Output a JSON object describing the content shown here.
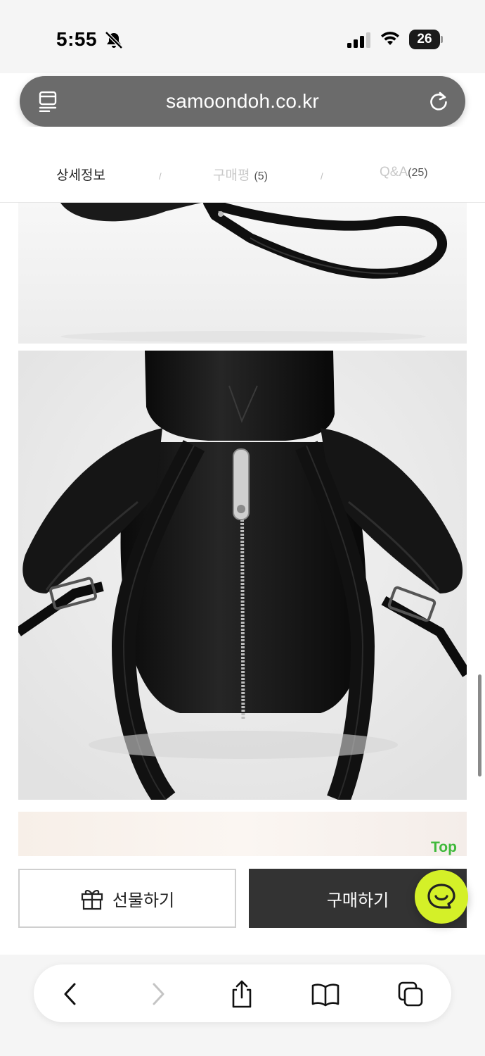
{
  "status_bar": {
    "time": "5:55",
    "battery": "26",
    "icons": [
      "bell-slash-icon",
      "signal-icon",
      "wifi-icon",
      "battery-icon"
    ]
  },
  "address_bar": {
    "url": "samoondoh.co.kr",
    "left_icon": "reader-icon",
    "right_icon": "reload-icon"
  },
  "tabs": [
    {
      "label": "상세정보",
      "count": "",
      "active": true
    },
    {
      "label": "구매평",
      "count": "(5)",
      "active": false
    },
    {
      "label": "Q&A",
      "count": "(25)",
      "active": false
    }
  ],
  "tab_separator": "/",
  "images": [
    {
      "subject": "black leather strap on white background"
    },
    {
      "subject": "black leather bear backpack, back view with zipper and straps"
    },
    {
      "subject": "next product image (partially visible)"
    }
  ],
  "top_button": "Top",
  "purchase_bar": {
    "gift_label": "선물하기",
    "buy_label": "구매하기",
    "chat_icon": "chat-icon"
  },
  "safari_toolbar": [
    "back-icon",
    "forward-icon",
    "share-icon",
    "bookmarks-icon",
    "tabs-icon"
  ],
  "colors": {
    "accent_green": "#3fb93b",
    "chat_button": "#d4f028",
    "buy_button": "#333333",
    "address_bar": "#6b6b6b"
  }
}
